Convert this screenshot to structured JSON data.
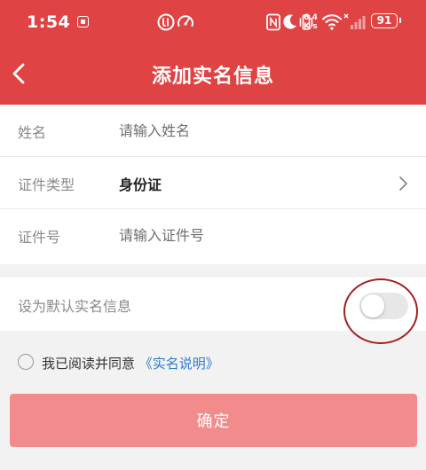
{
  "status_bar": {
    "time": "1:54",
    "network_speed_value": "6.4",
    "network_speed_unit": "K/s",
    "battery": "91",
    "icons": [
      "notification-icon",
      "app-icon",
      "speedometer-icon",
      "nfc-icon",
      "moon-icon",
      "vibrate-icon",
      "wifi-icon",
      "cellular-signal-icon",
      "battery-icon"
    ]
  },
  "header": {
    "title": "添加实名信息",
    "back_icon": "chevron-left-icon",
    "background_color": "#e04343"
  },
  "form": {
    "rows": [
      {
        "label": "姓名",
        "placeholder": "请输入姓名",
        "value": ""
      },
      {
        "label": "证件类型",
        "value": "身份证",
        "icon": "chevron-right-icon"
      },
      {
        "label": "证件号",
        "placeholder": "请输入证件号",
        "value": ""
      }
    ]
  },
  "default_setting": {
    "label": "设为默认实名信息",
    "toggle_on": false
  },
  "agreement": {
    "text": "我已阅读并同意 ",
    "link": "《实名说明》",
    "checked": false,
    "link_color": "#2f7bd3"
  },
  "confirm_button": {
    "label": "确定",
    "color": "#f28b8b"
  },
  "annotation": {
    "color": "#a31d1d"
  }
}
